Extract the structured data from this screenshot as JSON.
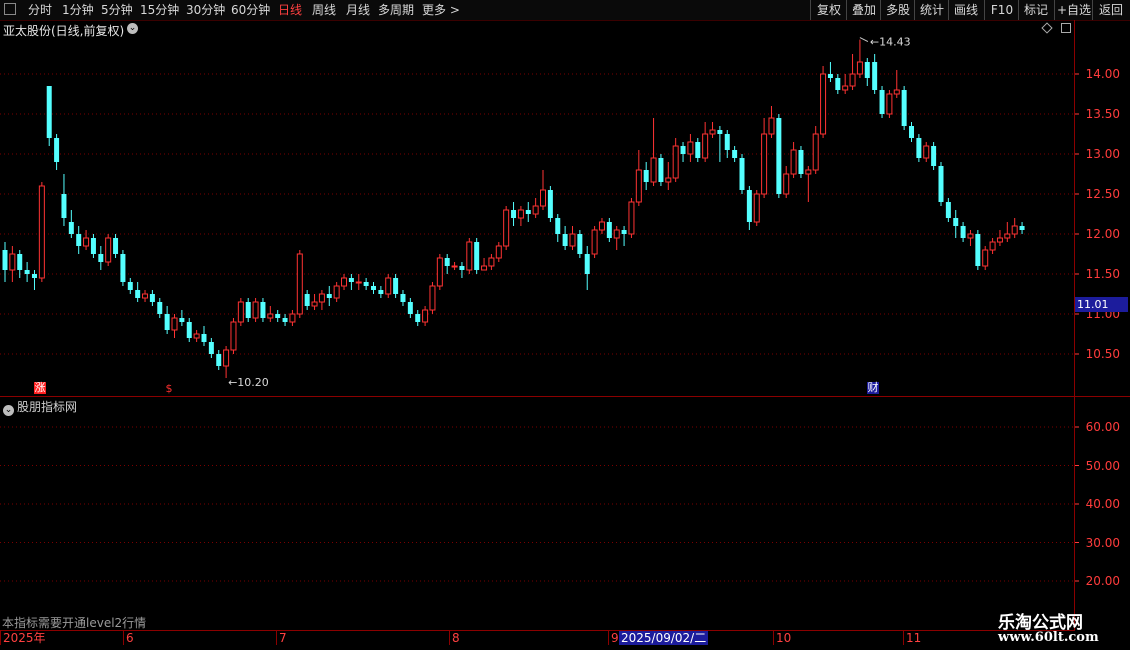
{
  "toolbar": {
    "timeframes": [
      "分时",
      "1分钟",
      "5分钟",
      "15分钟",
      "30分钟",
      "60分钟",
      "日线",
      "周线",
      "月线",
      "多周期",
      "更多 >"
    ],
    "active_timeframe": "日线",
    "right_buttons": [
      "复权",
      "叠加",
      "多股",
      "统计",
      "画线",
      "F10",
      "标记",
      "+自选",
      "返回"
    ]
  },
  "chart": {
    "title": "亚太股份(日线,前复权)",
    "price_axis": [
      "14.00",
      "13.50",
      "13.00",
      "12.50",
      "12.00",
      "11.50",
      "11.00",
      "10.50"
    ],
    "current_price_tag": "11.01",
    "high_marker": "14.43",
    "low_marker": "10.20",
    "markers": {
      "zhang": "涨",
      "dollar": "$",
      "cai": "财"
    }
  },
  "indicator": {
    "title": "股朋指标网",
    "axis": [
      "60.00",
      "50.00",
      "40.00",
      "30.00",
      "20.00"
    ],
    "note": "本指标需要开通level2行情"
  },
  "datebar": {
    "labels": [
      "2025年",
      "6",
      "7",
      "8",
      "9",
      "10",
      "11"
    ],
    "selected_date": "2025/09/02/二"
  },
  "watermark": {
    "line1": "乐淘公式网",
    "line2": "www.60lt.com"
  },
  "colors": {
    "up": "#ff3333",
    "down": "#54ffff",
    "axis": "#ff3c3c",
    "grid": "#7a0000"
  },
  "chart_data": {
    "type": "candlestick",
    "ylim": [
      10.2,
      14.43
    ],
    "candles": [
      [
        11.8,
        11.55,
        11.9,
        11.4
      ],
      [
        11.55,
        11.75,
        11.85,
        11.4
      ],
      [
        11.75,
        11.55,
        11.8,
        11.45
      ],
      [
        11.55,
        11.5,
        11.65,
        11.4
      ],
      [
        11.5,
        11.45,
        11.55,
        11.3
      ],
      [
        11.45,
        12.6,
        12.65,
        11.4
      ],
      [
        13.85,
        13.2,
        13.85,
        13.1
      ],
      [
        13.2,
        12.9,
        13.25,
        12.8
      ],
      [
        12.5,
        12.2,
        12.75,
        12.1
      ],
      [
        12.15,
        12.0,
        12.3,
        11.95
      ],
      [
        12.0,
        11.85,
        12.1,
        11.75
      ],
      [
        11.85,
        11.95,
        12.05,
        11.8
      ],
      [
        11.95,
        11.75,
        12.0,
        11.7
      ],
      [
        11.75,
        11.65,
        11.85,
        11.55
      ],
      [
        11.65,
        11.95,
        12.0,
        11.6
      ],
      [
        11.95,
        11.75,
        12.0,
        11.7
      ],
      [
        11.75,
        11.4,
        11.8,
        11.35
      ],
      [
        11.4,
        11.3,
        11.45,
        11.25
      ],
      [
        11.3,
        11.2,
        11.4,
        11.15
      ],
      [
        11.2,
        11.25,
        11.3,
        11.15
      ],
      [
        11.25,
        11.15,
        11.3,
        11.1
      ],
      [
        11.15,
        11.0,
        11.2,
        10.95
      ],
      [
        11.0,
        10.8,
        11.1,
        10.75
      ],
      [
        10.8,
        10.95,
        11.0,
        10.7
      ],
      [
        10.95,
        10.9,
        11.05,
        10.85
      ],
      [
        10.9,
        10.7,
        10.95,
        10.65
      ],
      [
        10.7,
        10.75,
        10.8,
        10.65
      ],
      [
        10.75,
        10.65,
        10.85,
        10.6
      ],
      [
        10.65,
        10.5,
        10.7,
        10.45
      ],
      [
        10.5,
        10.35,
        10.55,
        10.3
      ],
      [
        10.35,
        10.55,
        10.6,
        10.2
      ],
      [
        10.55,
        10.9,
        10.95,
        10.5
      ],
      [
        10.9,
        11.15,
        11.2,
        10.85
      ],
      [
        11.15,
        10.95,
        11.2,
        10.9
      ],
      [
        10.95,
        11.15,
        11.2,
        10.9
      ],
      [
        11.15,
        10.95,
        11.2,
        10.9
      ],
      [
        10.95,
        11.0,
        11.1,
        10.9
      ],
      [
        11.0,
        10.95,
        11.05,
        10.9
      ],
      [
        10.95,
        10.9,
        11.0,
        10.85
      ],
      [
        10.9,
        11.0,
        11.05,
        10.85
      ],
      [
        11.0,
        11.75,
        11.8,
        10.95
      ],
      [
        11.25,
        11.1,
        11.3,
        11.05
      ],
      [
        11.1,
        11.15,
        11.25,
        11.05
      ],
      [
        11.15,
        11.25,
        11.3,
        11.05
      ],
      [
        11.25,
        11.2,
        11.35,
        11.1
      ],
      [
        11.2,
        11.35,
        11.4,
        11.15
      ],
      [
        11.35,
        11.45,
        11.5,
        11.3
      ],
      [
        11.45,
        11.4,
        11.5,
        11.3
      ],
      [
        11.4,
        11.4,
        11.5,
        11.3
      ],
      [
        11.4,
        11.35,
        11.45,
        11.3
      ],
      [
        11.35,
        11.3,
        11.4,
        11.25
      ],
      [
        11.3,
        11.25,
        11.35,
        11.2
      ],
      [
        11.25,
        11.45,
        11.5,
        11.2
      ],
      [
        11.45,
        11.25,
        11.5,
        11.2
      ],
      [
        11.25,
        11.15,
        11.3,
        11.1
      ],
      [
        11.15,
        11.0,
        11.2,
        10.95
      ],
      [
        11.0,
        10.9,
        11.05,
        10.85
      ],
      [
        10.9,
        11.05,
        11.1,
        10.85
      ],
      [
        11.05,
        11.35,
        11.4,
        11.0
      ],
      [
        11.35,
        11.7,
        11.75,
        11.3
      ],
      [
        11.7,
        11.6,
        11.75,
        11.5
      ],
      [
        11.6,
        11.6,
        11.65,
        11.55
      ],
      [
        11.6,
        11.55,
        11.65,
        11.45
      ],
      [
        11.55,
        11.9,
        11.95,
        11.5
      ],
      [
        11.9,
        11.55,
        11.95,
        11.5
      ],
      [
        11.55,
        11.6,
        11.7,
        11.55
      ],
      [
        11.6,
        11.7,
        11.75,
        11.55
      ],
      [
        11.7,
        11.85,
        11.9,
        11.65
      ],
      [
        11.85,
        12.3,
        12.35,
        11.8
      ],
      [
        12.3,
        12.2,
        12.4,
        12.1
      ],
      [
        12.2,
        12.3,
        12.35,
        12.1
      ],
      [
        12.3,
        12.25,
        12.4,
        12.15
      ],
      [
        12.25,
        12.35,
        12.45,
        12.2
      ],
      [
        12.35,
        12.55,
        12.8,
        12.3
      ],
      [
        12.55,
        12.2,
        12.6,
        12.15
      ],
      [
        12.2,
        12.0,
        12.25,
        11.9
      ],
      [
        12.0,
        11.85,
        12.1,
        11.8
      ],
      [
        11.85,
        12.0,
        12.1,
        11.8
      ],
      [
        12.0,
        11.75,
        12.05,
        11.7
      ],
      [
        11.75,
        11.5,
        11.85,
        11.3
      ],
      [
        11.75,
        12.05,
        12.1,
        11.7
      ],
      [
        12.05,
        12.15,
        12.2,
        12.0
      ],
      [
        12.15,
        11.95,
        12.2,
        11.9
      ],
      [
        11.95,
        12.05,
        12.1,
        11.8
      ],
      [
        12.05,
        12.0,
        12.1,
        11.85
      ],
      [
        12.0,
        12.4,
        12.45,
        11.95
      ],
      [
        12.4,
        12.8,
        13.05,
        12.35
      ],
      [
        12.8,
        12.65,
        12.9,
        12.55
      ],
      [
        12.65,
        12.95,
        13.45,
        12.6
      ],
      [
        12.95,
        12.65,
        13.0,
        12.6
      ],
      [
        12.65,
        12.7,
        12.9,
        12.55
      ],
      [
        12.7,
        13.1,
        13.2,
        12.65
      ],
      [
        13.1,
        13.0,
        13.15,
        12.9
      ],
      [
        13.0,
        13.15,
        13.25,
        12.9
      ],
      [
        13.15,
        12.95,
        13.2,
        12.9
      ],
      [
        12.95,
        13.25,
        13.4,
        12.9
      ],
      [
        13.25,
        13.3,
        13.4,
        13.2
      ],
      [
        13.3,
        13.25,
        13.35,
        12.9
      ],
      [
        13.25,
        13.05,
        13.3,
        12.95
      ],
      [
        13.05,
        12.95,
        13.1,
        12.9
      ],
      [
        12.95,
        12.55,
        13.0,
        12.5
      ],
      [
        12.55,
        12.15,
        12.6,
        12.05
      ],
      [
        12.15,
        12.5,
        12.55,
        12.1
      ],
      [
        12.5,
        13.25,
        13.45,
        12.45
      ],
      [
        13.25,
        13.45,
        13.6,
        13.2
      ],
      [
        13.45,
        12.5,
        13.5,
        12.45
      ],
      [
        12.5,
        12.75,
        12.85,
        12.45
      ],
      [
        12.75,
        13.05,
        13.15,
        12.7
      ],
      [
        13.05,
        12.75,
        13.1,
        12.7
      ],
      [
        12.75,
        12.8,
        12.85,
        12.4
      ],
      [
        12.8,
        13.25,
        13.35,
        12.75
      ],
      [
        13.25,
        14.0,
        14.1,
        13.2
      ],
      [
        14.0,
        13.95,
        14.15,
        13.9
      ],
      [
        13.95,
        13.8,
        14.0,
        13.75
      ],
      [
        13.8,
        13.85,
        14.0,
        13.75
      ],
      [
        13.85,
        14.0,
        14.25,
        13.8
      ],
      [
        14.0,
        14.15,
        14.43,
        13.95
      ],
      [
        14.15,
        13.95,
        14.2,
        13.85
      ],
      [
        14.15,
        13.8,
        14.25,
        13.75
      ],
      [
        13.8,
        13.5,
        13.85,
        13.45
      ],
      [
        13.5,
        13.75,
        13.8,
        13.45
      ],
      [
        13.75,
        13.8,
        14.05,
        13.7
      ],
      [
        13.8,
        13.35,
        13.85,
        13.3
      ],
      [
        13.35,
        13.2,
        13.4,
        13.15
      ],
      [
        13.2,
        12.95,
        13.25,
        12.9
      ],
      [
        12.95,
        13.1,
        13.15,
        12.9
      ],
      [
        13.1,
        12.85,
        13.15,
        12.8
      ],
      [
        12.85,
        12.4,
        12.9,
        12.35
      ],
      [
        12.4,
        12.2,
        12.45,
        12.15
      ],
      [
        12.2,
        12.1,
        12.3,
        11.95
      ],
      [
        12.1,
        11.95,
        12.15,
        11.9
      ],
      [
        11.95,
        12.0,
        12.05,
        11.85
      ],
      [
        12.0,
        11.6,
        12.05,
        11.55
      ],
      [
        11.6,
        11.8,
        11.85,
        11.55
      ],
      [
        11.8,
        11.9,
        11.95,
        11.75
      ],
      [
        11.9,
        11.95,
        12.05,
        11.85
      ],
      [
        11.95,
        12.0,
        12.15,
        11.9
      ],
      [
        12.0,
        12.1,
        12.2,
        11.95
      ],
      [
        12.1,
        12.05,
        12.15,
        12.0
      ]
    ]
  }
}
